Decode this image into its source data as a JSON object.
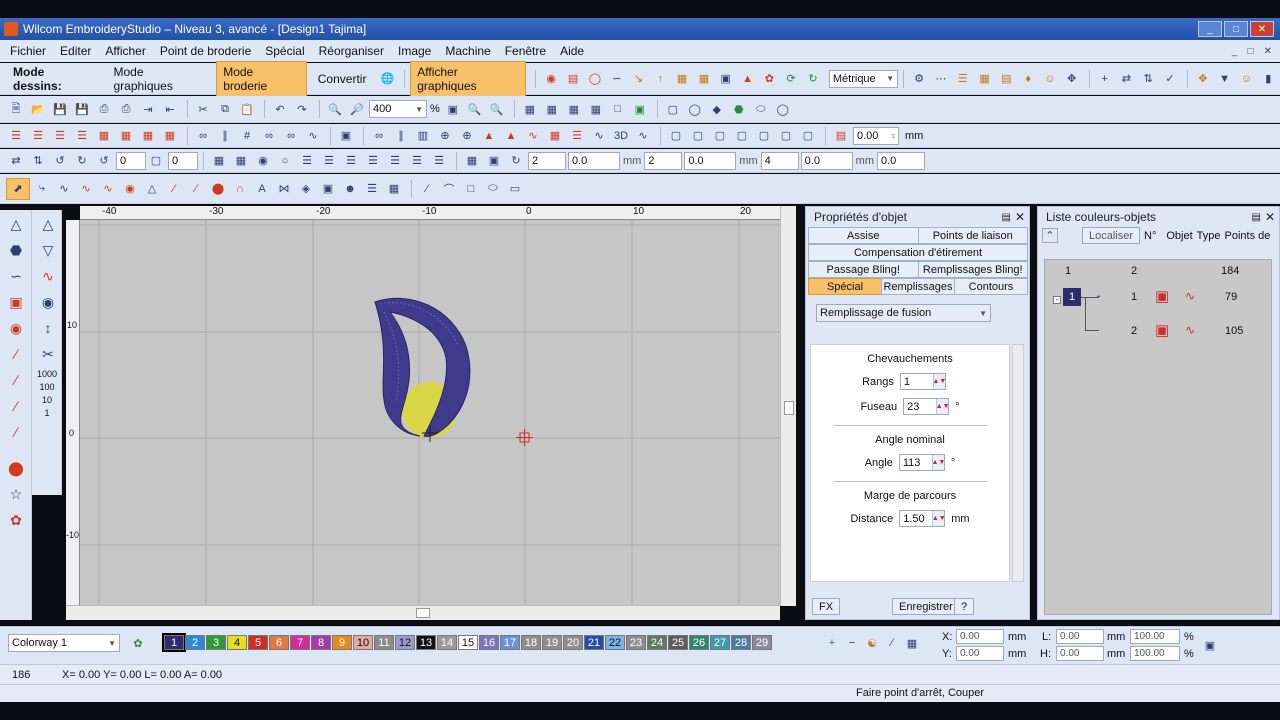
{
  "window": {
    "title": "Wilcom EmbroideryStudio – Niveau 3, avancé - [Design1          Tajima]",
    "controls": [
      "_",
      "□",
      "✕"
    ]
  },
  "menubar": {
    "items": [
      "Fichier",
      "Editer",
      "Afficher",
      "Point de broderie",
      "Spécial",
      "Réorganiser",
      "Image",
      "Machine",
      "Fenêtre",
      "Aide"
    ],
    "doc_controls": [
      "_",
      "□",
      "✕"
    ]
  },
  "toolbar_mode": {
    "label": "Mode dessins:",
    "graphics_mode": "Mode graphiques",
    "embroidery_mode": "Mode broderie",
    "convert": "Convertir",
    "show_graphics": "Afficher graphiques",
    "units": "Métrique"
  },
  "toolbar_zoom": {
    "zoom_value": "400",
    "zoom_unit": "%"
  },
  "toolbar_stitch": {
    "value": "0.00",
    "unit": "mm"
  },
  "toolbar_transform": {
    "fields": [
      "0",
      "0",
      "2",
      "0.0",
      "mm",
      "2",
      "0.0",
      "mm",
      "4",
      "0.0",
      "mm",
      "0.0"
    ]
  },
  "rulers": {
    "top_labels": [
      "-40",
      "-30",
      "-20",
      "-10",
      "0",
      "10",
      "20"
    ],
    "left_labels": [
      "10",
      "0",
      "-10"
    ]
  },
  "left_toolbar2_labels": [
    "1000",
    "100",
    "10",
    "1"
  ],
  "properties": {
    "title": "Propriétés d'objet",
    "tabs_row1": [
      "Assise",
      "Points de liaison"
    ],
    "tabs_row2": [
      "Compensation d'étirement"
    ],
    "tabs_row3": [
      "Passage Bling!",
      "Remplissages Bling!"
    ],
    "tabs_row4": [
      "Spécial",
      "Remplissages",
      "Contours"
    ],
    "fill_type": "Remplissage de fusion",
    "overlap_title": "Chevauchements",
    "rows_label": "Rangs",
    "rows_value": "1",
    "spindle_label": "Fuseau",
    "spindle_value": "23",
    "spindle_unit": "°",
    "angle_title": "Angle nominal",
    "angle_label": "Angle",
    "angle_value": "113",
    "angle_unit": "°",
    "margin_title": "Marge de parcours",
    "distance_label": "Distance",
    "distance_value": "1.50",
    "distance_unit": "mm",
    "fx_button": "FX",
    "save_button": "Enregistrer",
    "help_button": "?"
  },
  "color_list": {
    "title": "Liste couleurs-objets",
    "search_button": "Localiser",
    "columns": [
      "N°",
      "Objet",
      "Type",
      "Points de"
    ],
    "summary": {
      "col1": "1",
      "col2": "2",
      "points": "184"
    },
    "rows": [
      {
        "color": "1",
        "num": "1",
        "points": "79"
      },
      {
        "color": "",
        "num": "2",
        "points": "105"
      }
    ]
  },
  "bottom": {
    "colorway": "Colorway 1",
    "swatches": [
      {
        "n": "1",
        "c": "#2e2c6e"
      },
      {
        "n": "2",
        "c": "#2e8ad6"
      },
      {
        "n": "3",
        "c": "#2f9a35"
      },
      {
        "n": "4",
        "c": "#e6df1c"
      },
      {
        "n": "5",
        "c": "#d42a24"
      },
      {
        "n": "6",
        "c": "#e07a42"
      },
      {
        "n": "7",
        "c": "#d22d9e"
      },
      {
        "n": "8",
        "c": "#a43ba5"
      },
      {
        "n": "9",
        "c": "#e48a1e"
      },
      {
        "n": "10",
        "c": "#e8a9a0"
      },
      {
        "n": "11",
        "c": "#8c8c8c"
      },
      {
        "n": "12",
        "c": "#9a9bd0"
      },
      {
        "n": "13",
        "c": "#111111"
      },
      {
        "n": "14",
        "c": "#9a9a9a"
      },
      {
        "n": "15",
        "c": "#ffffff"
      },
      {
        "n": "16",
        "c": "#7a74b8"
      },
      {
        "n": "17",
        "c": "#6a93d6"
      },
      {
        "n": "18",
        "c": "#8e8e8e"
      },
      {
        "n": "19",
        "c": "#8e8e8e"
      },
      {
        "n": "20",
        "c": "#8e8e8e"
      },
      {
        "n": "21",
        "c": "#1f4fa6"
      },
      {
        "n": "22",
        "c": "#78b4e6"
      },
      {
        "n": "23",
        "c": "#8e8e8e"
      },
      {
        "n": "24",
        "c": "#5e7a5e"
      },
      {
        "n": "25",
        "c": "#5b5b5b"
      },
      {
        "n": "26",
        "c": "#2d8a6e"
      },
      {
        "n": "27",
        "c": "#3b9ab0"
      },
      {
        "n": "28",
        "c": "#4d7c9e"
      },
      {
        "n": "29",
        "c": "#8b8b9b"
      }
    ],
    "x_label": "X:",
    "x_value": "0.00",
    "y_label": "Y:",
    "y_value": "0.00",
    "l_label": "L:",
    "l_value": "0.00",
    "h_label": "H:",
    "h_value": "0.00",
    "unit": "mm",
    "scale_w": "100.00",
    "scale_h": "100.00",
    "pct": "%"
  },
  "status": {
    "stitch_count": "186",
    "coords": "X=   0.00 Y=   0.00 L=   0.00 A=    0.00",
    "hint": "Faire point d'arrêt, Couper"
  },
  "colors": {
    "accent": "#f9c06a",
    "stitch": "#3f3a8c",
    "highlight": "#d8d83a"
  }
}
